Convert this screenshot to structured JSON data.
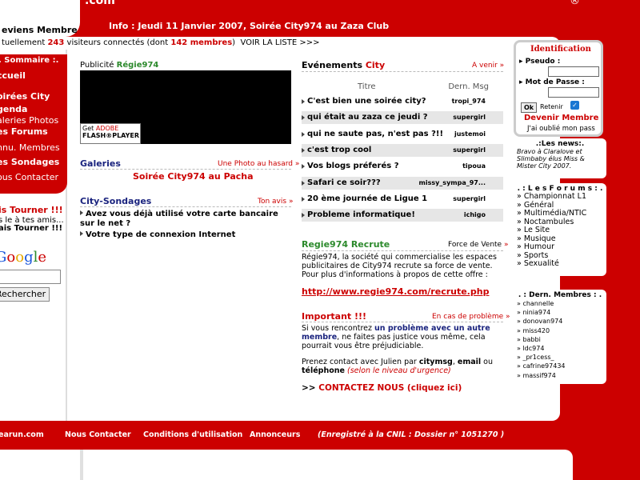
{
  "header": {
    "logo_suffix": ".com",
    "welcome": "eviens Membre",
    "info": "Info : Jeudi 11 Janvier 2007, Soirée City974 au Zaza Club",
    "visitors_prefix": "tuellement",
    "visitors_count": "243",
    "visitors_mid": "visiteurs connectés (dont",
    "members_count": "142 membres",
    "visitors_suffix": ")",
    "voir_liste": "VOIR LA LISTE >>>"
  },
  "left": {
    "menu_title": ". Sommaire :.",
    "items": [
      "ccueil",
      "oirées City",
      "genda",
      "aleries Photos",
      "es Forums",
      "nnu. Membres",
      "es Sondages",
      "ous Contacter"
    ],
    "tourner_title": "is Tourner !!!",
    "tourner_text": "s le à tes amis...",
    "tourner_link": "ais Tourner !!!",
    "google_logo": "Google",
    "search_button": "Rechercher"
  },
  "pub": {
    "label": "Publicité",
    "brand": "Régie974",
    "flash_get": "Get",
    "flash_adobe": "ADOBE",
    "flash_player": "FLASH®PLAYER"
  },
  "galeries": {
    "title": "Galeries",
    "right": "Une Photo au hasard",
    "photo": "Soirée City974 au Pacha"
  },
  "sondages": {
    "title": "City-Sondages",
    "right": "Ton avis",
    "q1": "Avez vous déjà utilisé votre carte bancaire sur le net ?",
    "q2": "Votre type de connexion Internet"
  },
  "events": {
    "title_prefix": "Evénements",
    "title_brand": "City",
    "right": "A venir",
    "col_titre": "Titre",
    "col_msg": "Dern. Msg",
    "rows": [
      {
        "title": "C'est bien une soirée city?",
        "user": "tropi_974"
      },
      {
        "title": "qui était au zaza ce jeudi ?",
        "user": "supergirl"
      },
      {
        "title": "qui ne saute pas, n'est pas ?!!",
        "user": "justemoi"
      },
      {
        "title": "c'est trop cool",
        "user": "supergirl"
      },
      {
        "title": "Vos blogs préferés ?",
        "user": "tipoua"
      },
      {
        "title": "Safari ce soir???",
        "user": "missy_sympa_97..."
      },
      {
        "title": "20 ème journée de Ligue 1",
        "user": "supergirl"
      },
      {
        "title": "Probleme informatique!",
        "user": "ichigo"
      }
    ]
  },
  "recrute": {
    "title": "Regie974 Recrute",
    "right": "Force de Vente",
    "text": "Régie974, la société qui commercialise les espaces publicitaires de City974 recrute sa force de vente.",
    "text2": "Pour plus d'informations à propos de cette offre :",
    "link": "http://www.regie974.com/recrute.php"
  },
  "important": {
    "title": "Important !!!",
    "right": "En cas de problème",
    "p1a": "Si vous rencontrez",
    "p1b": "un problème avec un autre membre",
    "p1c": ", ne faites pas justice vous même, cela pourrait vous être préjudiciable.",
    "p2a": "Prenez contact avec Julien par",
    "p2b": "citymsg",
    "p2c": ", ",
    "p2d": "email",
    "p2e": " ou ",
    "p2f": "téléphone",
    "p2g": "(selon le niveau d'urgence)",
    "contact_prefix": ">>",
    "contact_link": "CONTACTEZ NOUS (cliquez ici)"
  },
  "ident": {
    "title": "Identification",
    "pseudo": "Pseudo :",
    "password": "Mot de Passe :",
    "ok": "Ok",
    "retenir": "Retenir",
    "devenir": "Devenir Membre",
    "forgot": "J'ai oublié mon pass"
  },
  "news": {
    "title": ".:Les news:.",
    "text": "Bravo à Claralove et Slimbaby élus Miss & Mister City 2007."
  },
  "forums": {
    "title": ". : L e s F o r u m s : .",
    "items": [
      "Championnat L1",
      "Général",
      "Multimédia/NTIC",
      "Noctambules",
      "Le Site",
      "Musique",
      "Humour",
      "Sports",
      "Sexualité"
    ]
  },
  "members": {
    "title": ". : Dern. Membres : .",
    "items": [
      "channelle",
      "ninia974",
      "donovan974",
      "miss420",
      "babbi",
      "ldc974",
      "_pr1cess_",
      "cafrine97434",
      "massif974"
    ]
  },
  "footer": {
    "links": [
      "earun.com",
      "Nous Contacter",
      "Conditions d'utilisation",
      "Annonceurs"
    ],
    "cnil": "(Enregistré à la CNIL : Dossier n° 1051270 )"
  }
}
